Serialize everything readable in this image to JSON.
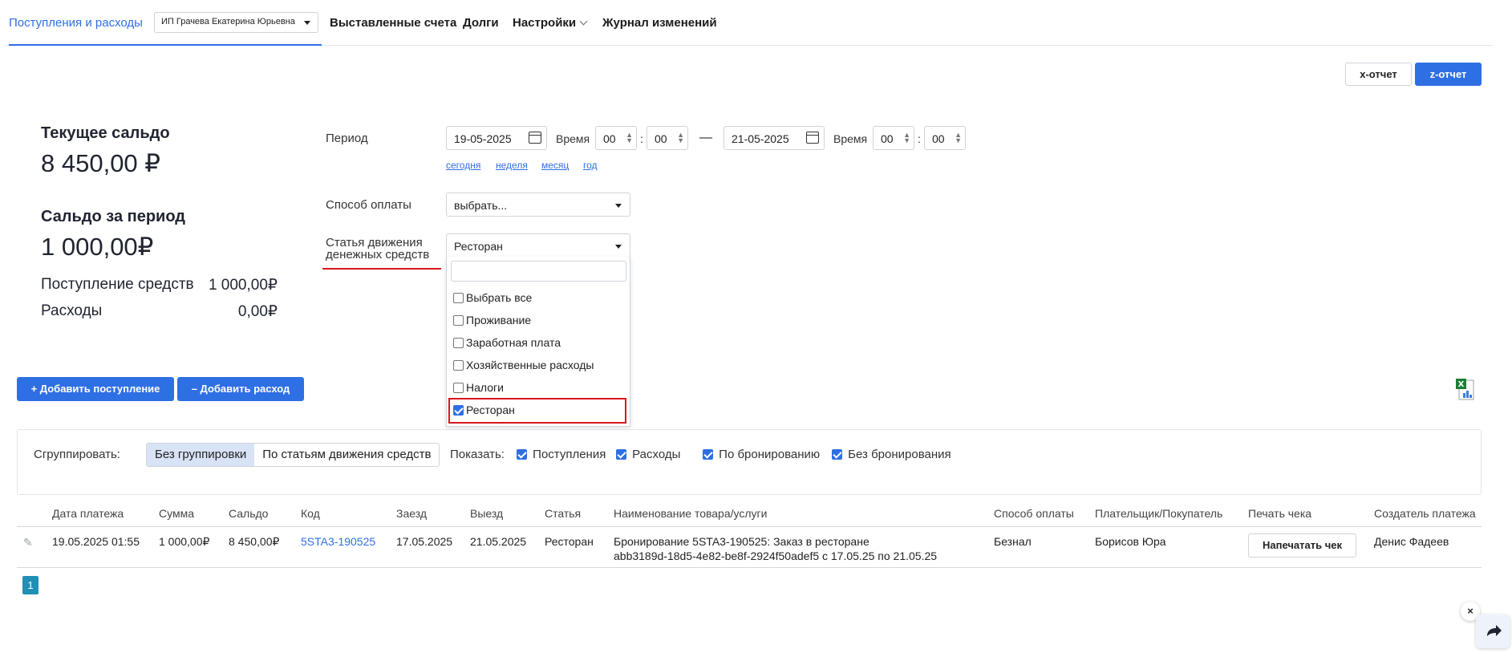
{
  "nav": {
    "income_expenses": "Поступления и расходы",
    "org": "ИП Грачева Екатерина Юрьевна",
    "invoices": "Выставленные счета",
    "debts": "Долги",
    "settings": "Настройки",
    "changelog": "Журнал изменений"
  },
  "reports": {
    "x": "x-отчет",
    "z": "z-отчет"
  },
  "balance": {
    "current_title": "Текущее сальдо",
    "current_value": "8 450,00 ₽",
    "period_title": "Сальдо за период",
    "period_value": "1 000,00₽",
    "income_label": "Поступление средств",
    "income_value": "1 000,00₽",
    "expenses_label": "Расходы",
    "expenses_value": "0,00₽"
  },
  "filters": {
    "period_label": "Период",
    "date_from": "19-05-2025",
    "time_label": "Время",
    "time_from_h": "00",
    "time_from_m": "00",
    "dash": "—",
    "date_to": "21-05-2025",
    "time_to_h": "00",
    "time_to_m": "00",
    "colon": ":",
    "quick": [
      "сегодня",
      "неделя",
      "месяц",
      "год"
    ],
    "payment_label": "Способ оплаты",
    "payment_value": "выбрать...",
    "article_label_1": "Статья движения",
    "article_label_2": "денежных средств",
    "article_value": "Ресторан",
    "dropdown_items": [
      {
        "label": "Выбрать все",
        "checked": false
      },
      {
        "label": "Проживание",
        "checked": false
      },
      {
        "label": "Заработная плата",
        "checked": false
      },
      {
        "label": "Хозяйственные расходы",
        "checked": false
      },
      {
        "label": "Налоги",
        "checked": false
      },
      {
        "label": "Ресторан",
        "checked": true
      }
    ]
  },
  "actions": {
    "add_income": "+ Добавить поступление",
    "add_expense": "– Добавить расход",
    "excel_icon": "excel-export-icon"
  },
  "grouping": {
    "label": "Сгруппировать:",
    "none": "Без группировки",
    "by_article": "По статьям движения средств",
    "show_label": "Показать:",
    "show": [
      {
        "label": "Поступления",
        "checked": true
      },
      {
        "label": "Расходы",
        "checked": true
      },
      {
        "label": "По бронированию",
        "checked": true
      },
      {
        "label": "Без бронирования",
        "checked": true
      }
    ]
  },
  "table": {
    "headers": [
      "Дата платежа",
      "Сумма",
      "Сальдо",
      "Код",
      "Заезд",
      "Выезд",
      "Статья",
      "Наименование товара/услуги",
      "Способ оплаты",
      "Плательщик/Покупатель",
      "Печать чека",
      "Создатель платежа"
    ],
    "row": {
      "date": "19.05.2025 01:55",
      "sum": "1 000,00₽",
      "balance": "8 450,00₽",
      "code": "5STA3-190525",
      "checkin": "17.05.2025",
      "checkout": "21.05.2025",
      "article": "Ресторан",
      "name_1": "Бронирование 5STA3-190525: Заказ в ресторане",
      "name_2": "abb3189d-18d5-4e82-be8f-2924f50adef5 с 17.05.25 по 21.05.25",
      "payment": "Безнал",
      "payer": "Борисов Юра",
      "print": "Напечатать чек",
      "creator": "Денис Фадеев"
    }
  },
  "pagination": {
    "current": "1"
  },
  "fab": {
    "close": "×"
  },
  "colors": {
    "accent": "#2f6fe4",
    "highlight": "#d9161c",
    "page": "#1f8fb5"
  }
}
